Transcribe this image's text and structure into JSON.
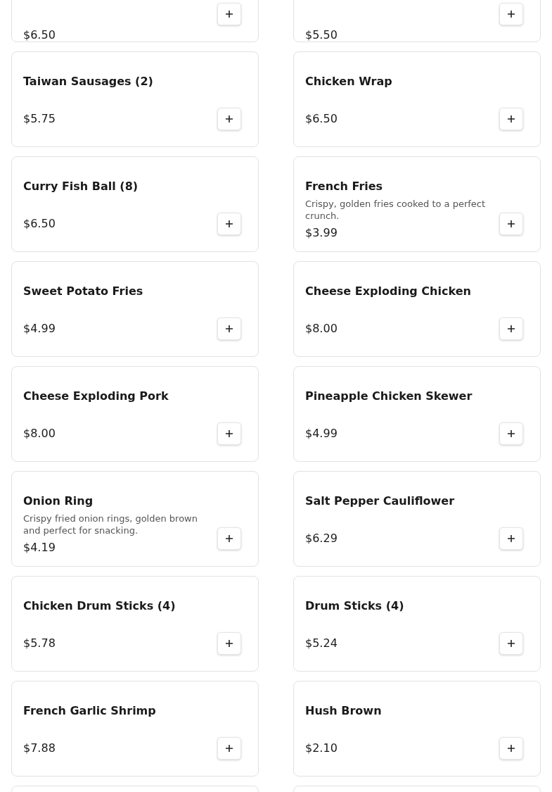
{
  "menu_items": [
    {
      "price": "$6.50"
    },
    {
      "price": "$5.50"
    },
    {
      "name": "Taiwan Sausages (2)",
      "price": "$5.75"
    },
    {
      "name": "Chicken Wrap",
      "price": "$6.50"
    },
    {
      "name": "Curry Fish Ball (8)",
      "price": "$6.50"
    },
    {
      "name": "French Fries",
      "description": "Crispy, golden fries cooked to a perfect crunch.",
      "price": "$3.99"
    },
    {
      "name": "Sweet Potato Fries",
      "price": "$4.99"
    },
    {
      "name": "Cheese Exploding Chicken",
      "price": "$8.00"
    },
    {
      "name": "Cheese Exploding Pork",
      "price": "$8.00"
    },
    {
      "name": "Pineapple Chicken Skewer",
      "price": "$4.99"
    },
    {
      "name": "Onion Ring",
      "description": "Crispy fried onion rings, golden brown and perfect for snacking.",
      "price": "$4.19"
    },
    {
      "name": "Salt Pepper Cauliflower",
      "price": "$6.29"
    },
    {
      "name": "Chicken Drum Sticks (4)",
      "price": "$5.78"
    },
    {
      "name": "Drum Sticks (4)",
      "price": "$5.24"
    },
    {
      "name": "French Garlic Shrimp",
      "price": "$7.88"
    },
    {
      "name": "Hush Brown",
      "price": "$2.10"
    }
  ]
}
